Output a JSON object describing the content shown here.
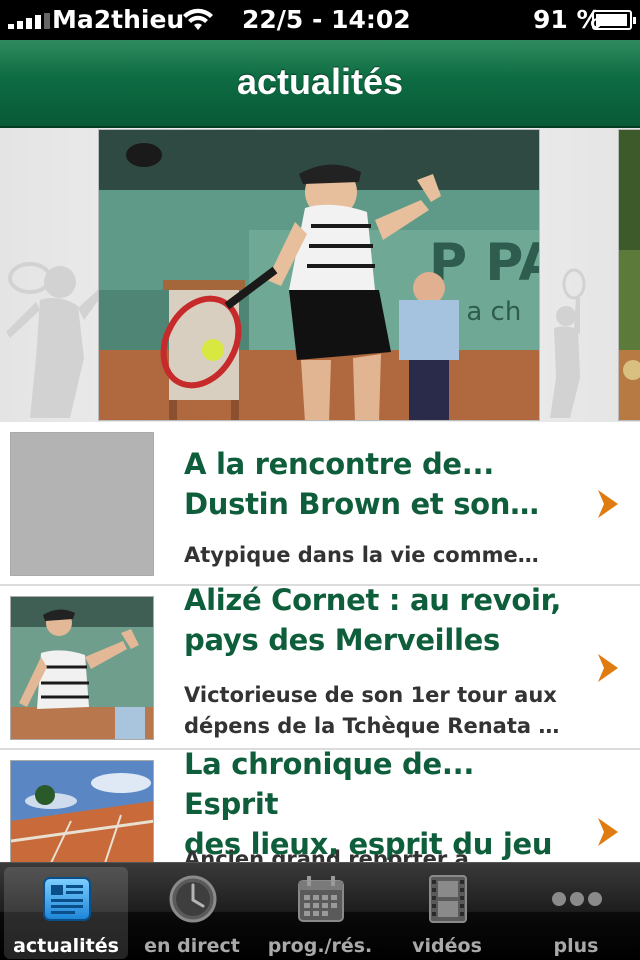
{
  "status_bar": {
    "carrier": "Ma2thieu",
    "datetime": "22/5 - 14:02",
    "battery_percent": "91 %"
  },
  "nav_bar": {
    "title": "actualités"
  },
  "articles": [
    {
      "headline": "A la rencontre de...\nDustin Brown et son…",
      "summary": "Atypique dans la vie comme…",
      "thumb": "placeholder"
    },
    {
      "headline": "Alizé Cornet : au revoir,\npays des Merveilles",
      "summary": "Victorieuse de son 1er tour aux\ndépens de la Tchèque Renata …",
      "thumb": "tennis-player-photo"
    },
    {
      "headline": "La chronique de... Esprit\ndes lieux, esprit du jeu",
      "summary": "Ancien grand reporter à",
      "thumb": "stadium-photo"
    }
  ],
  "tab_bar": {
    "tabs": [
      {
        "label": "actualités",
        "icon": "newspaper-icon",
        "active": true
      },
      {
        "label": "en direct",
        "icon": "clock-icon",
        "active": false
      },
      {
        "label": "prog./rés.",
        "icon": "calendar-icon",
        "active": false
      },
      {
        "label": "vidéos",
        "icon": "film-icon",
        "active": false
      },
      {
        "label": "plus",
        "icon": "more-icon",
        "active": false
      }
    ]
  },
  "colors": {
    "nav_green": "#0d6b42",
    "headline_green": "#0e5e3b",
    "chevron_orange": "#e07b10"
  }
}
